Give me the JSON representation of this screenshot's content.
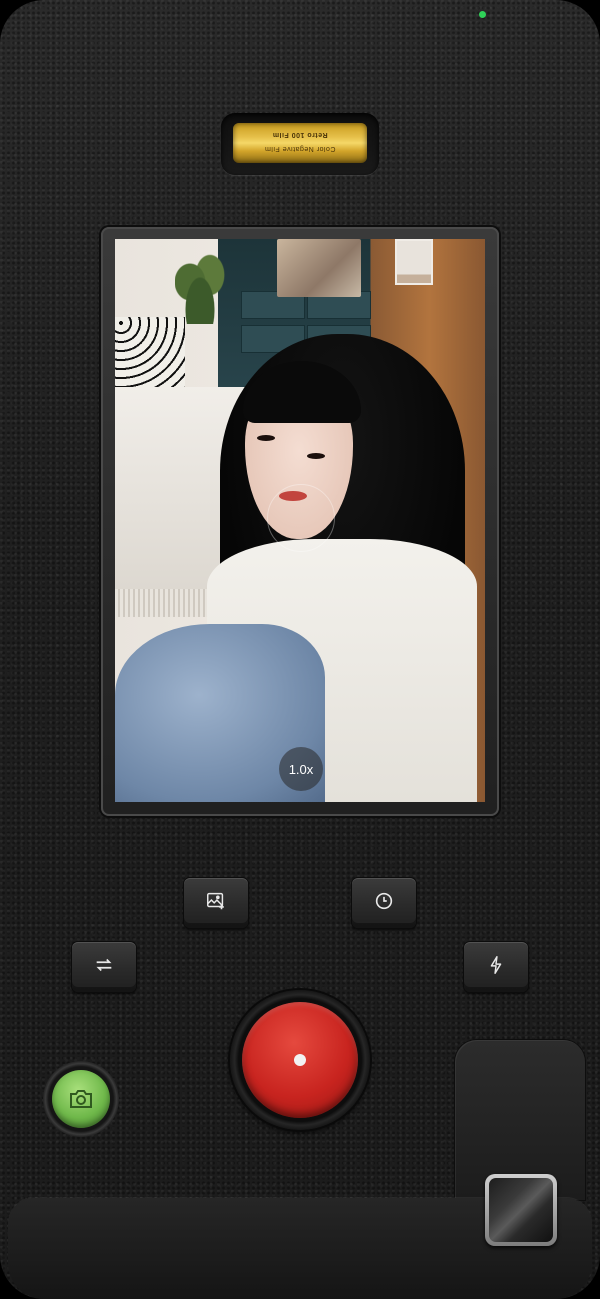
{
  "status": {
    "indicator_color": "#2fd158"
  },
  "film": {
    "line1": "Retro 100 Film",
    "line2": "Color Negative Film"
  },
  "viewfinder": {
    "zoom_label": "1.0x"
  },
  "controls": {
    "gallery_icon": "photo-add-icon",
    "timer_icon": "clock-icon",
    "flip_icon": "switch-camera-icon",
    "flash_icon": "flash-icon",
    "shutter_color": "#c8241f",
    "mode_icon": "camera-icon",
    "mode_color": "#6fb84a"
  }
}
